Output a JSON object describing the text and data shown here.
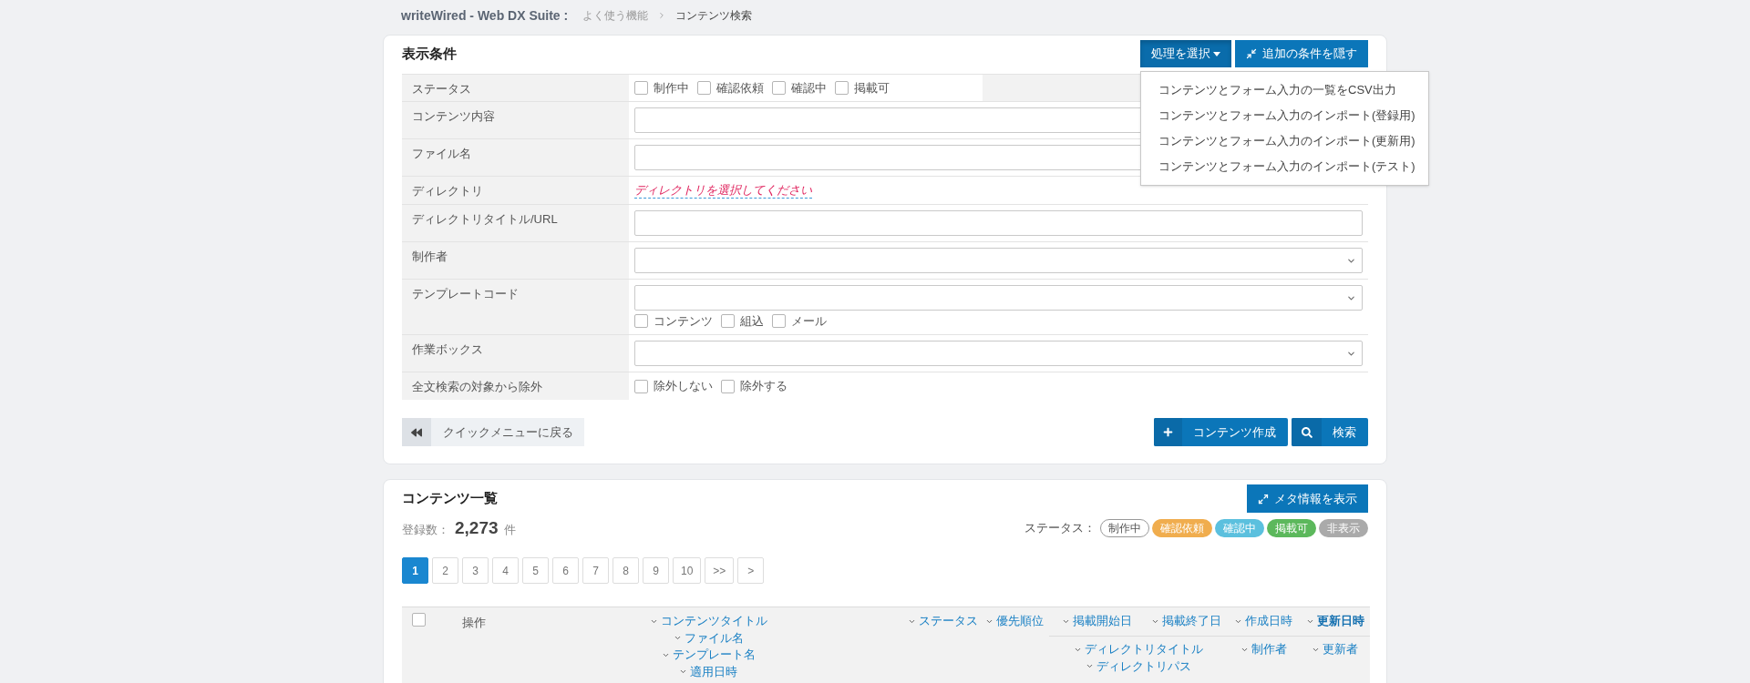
{
  "breadcrumb": {
    "app_title": "writeWired - Web DX Suite :",
    "items": [
      {
        "label": "よく使う機能",
        "current": false
      },
      {
        "label": "コンテンツ検索",
        "current": true
      }
    ]
  },
  "search_panel": {
    "title": "表示条件",
    "action_menu": {
      "label": "処理を選択",
      "expanded": true,
      "items": [
        "コンテンツとフォーム入力の一覧をCSV出力",
        "コンテンツとフォーム入力のインポート(登録用)",
        "コンテンツとフォーム入力のインポート(更新用)",
        "コンテンツとフォーム入力のインポート(テスト)"
      ]
    },
    "toggle_button": "追加の条件を隠す",
    "fields": [
      {
        "kind": "checkbox_panel",
        "label": "ステータス",
        "options": [
          {
            "label": "制作中",
            "checked": false
          },
          {
            "label": "確認依頼",
            "checked": false
          },
          {
            "label": "確認中",
            "checked": false
          },
          {
            "label": "掲載可",
            "checked": false
          }
        ]
      },
      {
        "kind": "text",
        "label": "コンテンツ内容"
      },
      {
        "kind": "text",
        "label": "ファイル名"
      },
      {
        "kind": "link",
        "label": "ディレクトリ",
        "link": "ディレクトリを選択してください"
      },
      {
        "kind": "text",
        "label": "ディレクトリタイトル/URL"
      },
      {
        "kind": "select",
        "label": "制作者"
      },
      {
        "kind": "select",
        "label": "テンプレートコード",
        "options": [
          {
            "label": "コンテンツ",
            "checked": false
          },
          {
            "label": "組込",
            "checked": false
          },
          {
            "label": "メール",
            "checked": false
          }
        ]
      },
      {
        "kind": "select",
        "label": "作業ボックス"
      },
      {
        "kind": "checkboxes",
        "label": "全文検索の対象から除外",
        "options": [
          {
            "label": "除外しない",
            "checked": false
          },
          {
            "label": "除外する",
            "checked": false
          }
        ]
      }
    ],
    "back_button": "クイックメニューに戻る",
    "create_button": "コンテンツ作成",
    "search_button": "検索"
  },
  "list_panel": {
    "title": "コンテンツ一覧",
    "meta_button": "メタ情報を表示",
    "count": {
      "label": "登録数：",
      "value": "2,273",
      "unit": "件"
    },
    "status_legend": {
      "label": "ステータス：",
      "items": [
        {
          "label": "制作中",
          "kind": "outline",
          "color": "#ffffff"
        },
        {
          "label": "確認依頼",
          "kind": "filled",
          "color": "#f0ad4e"
        },
        {
          "label": "確認中",
          "kind": "filled",
          "color": "#5bc0de"
        },
        {
          "label": "掲載可",
          "kind": "filled",
          "color": "#5cb85c"
        },
        {
          "label": "非表示",
          "kind": "filled",
          "color": "#aaaaaa"
        }
      ]
    },
    "pagination": [
      {
        "label": "1",
        "selected": true
      },
      {
        "label": "2",
        "selected": false
      },
      {
        "label": "3",
        "selected": false
      },
      {
        "label": "4",
        "selected": false
      },
      {
        "label": "5",
        "selected": false
      },
      {
        "label": "6",
        "selected": false
      },
      {
        "label": "7",
        "selected": false
      },
      {
        "label": "8",
        "selected": false
      },
      {
        "label": "9",
        "selected": false
      },
      {
        "label": "10",
        "selected": false
      },
      {
        "label": ">>",
        "selected": false
      },
      {
        "label": ">",
        "selected": false
      }
    ],
    "table": {
      "select_all_checked": false,
      "action_label": "操作",
      "tall_columns": [
        {
          "links": [
            {
              "label": "コンテンツタイトル",
              "active": false
            },
            {
              "label": "ファイル名",
              "active": false
            },
            {
              "label": "テンプレート名",
              "active": false
            },
            {
              "label": "適用日時",
              "active": false
            }
          ]
        },
        {
          "links": [
            {
              "label": "ステータス",
              "active": false
            }
          ]
        },
        {
          "links": [
            {
              "label": "優先順位",
              "active": false
            }
          ]
        }
      ],
      "upper_columns": [
        {
          "links": [
            {
              "label": "掲載開始日",
              "active": false
            }
          ]
        },
        {
          "links": [
            {
              "label": "掲載終了日",
              "active": false
            }
          ]
        },
        {
          "links": [
            {
              "label": "作成日時",
              "active": false
            }
          ]
        },
        {
          "links": [
            {
              "label": "更新日時",
              "active": true
            }
          ]
        }
      ],
      "lower_columns": [
        {
          "links": [
            {
              "label": "ディレクトリタイトル",
              "active": false
            },
            {
              "label": "ディレクトリパス",
              "active": false
            }
          ]
        },
        {
          "links": [
            {
              "label": "制作者",
              "active": false
            }
          ]
        },
        {
          "links": [
            {
              "label": "更新者",
              "active": false
            }
          ]
        }
      ]
    }
  }
}
